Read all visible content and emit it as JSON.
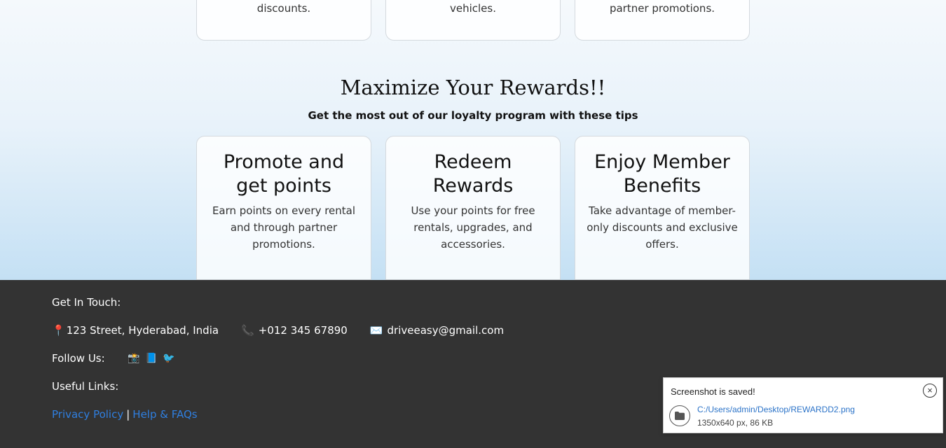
{
  "top_cards": [
    {
      "text": "discounts."
    },
    {
      "text": "vehicles."
    },
    {
      "text": "partner promotions."
    }
  ],
  "rewards": {
    "heading": "Maximize Your Rewards!!",
    "subheading": "Get the most out of our loyalty program with these tips",
    "cards": [
      {
        "title": "Promote and get points",
        "text": "Earn points on every rental and through partner promotions."
      },
      {
        "title": "Redeem Rewards",
        "text": "Use your points for free rentals, upgrades, and accessories."
      },
      {
        "title": "Enjoy Member Benefits",
        "text": "Take advantage of member-only discounts and exclusive offers."
      }
    ]
  },
  "footer": {
    "get_in_touch": "Get In Touch:",
    "address_icon": "📍",
    "address": "123 Street, Hyderabad, India",
    "phone_icon": "📞",
    "phone": "+012 345 67890",
    "email_icon": "✉️",
    "email": "driveeasy@gmail.com",
    "follow_us": "Follow Us:",
    "social": [
      "📸",
      "📘",
      "🐦"
    ],
    "useful_links": "Useful Links:",
    "privacy_policy": "Privacy Policy",
    "separator": "|",
    "help_faqs": "Help & FAQs"
  },
  "toast": {
    "title": "Screenshot is saved!",
    "close": "×",
    "path": "C:/Users/admin/Desktop/REWARDD2.png",
    "meta": "1350x640 px, 86 KB"
  },
  "colors": {
    "footer_bg": "#333333",
    "link": "#2f7fe0",
    "toast_link": "#2b73c8"
  }
}
